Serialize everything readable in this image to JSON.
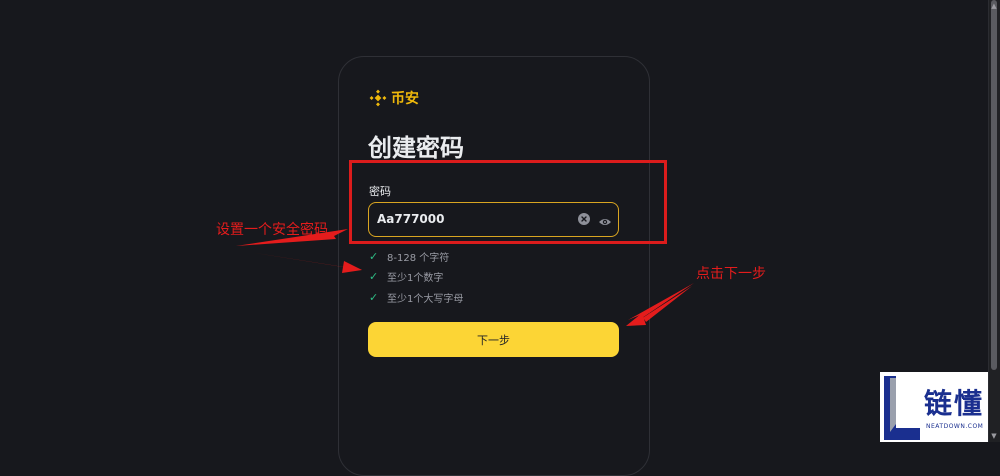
{
  "logo": {
    "name": "币安",
    "color": "#f0b90b"
  },
  "page_title": "创建密码",
  "password": {
    "label": "密码",
    "value": "Aa777000",
    "focus_color": "#d9a521"
  },
  "requirements": [
    {
      "text": "8-128 个字符",
      "met": true
    },
    {
      "text": "至少1个数字",
      "met": true
    },
    {
      "text": "至少1个大写字母",
      "met": true
    }
  ],
  "next_button": {
    "label": "下一步",
    "color": "#fcd535"
  },
  "annotations": {
    "left": "设置一个安全密码",
    "right": "点击下一步",
    "color": "#e41c1c"
  },
  "watermark": {
    "text": "链懂",
    "sub": "NEATDOWN.COM"
  }
}
